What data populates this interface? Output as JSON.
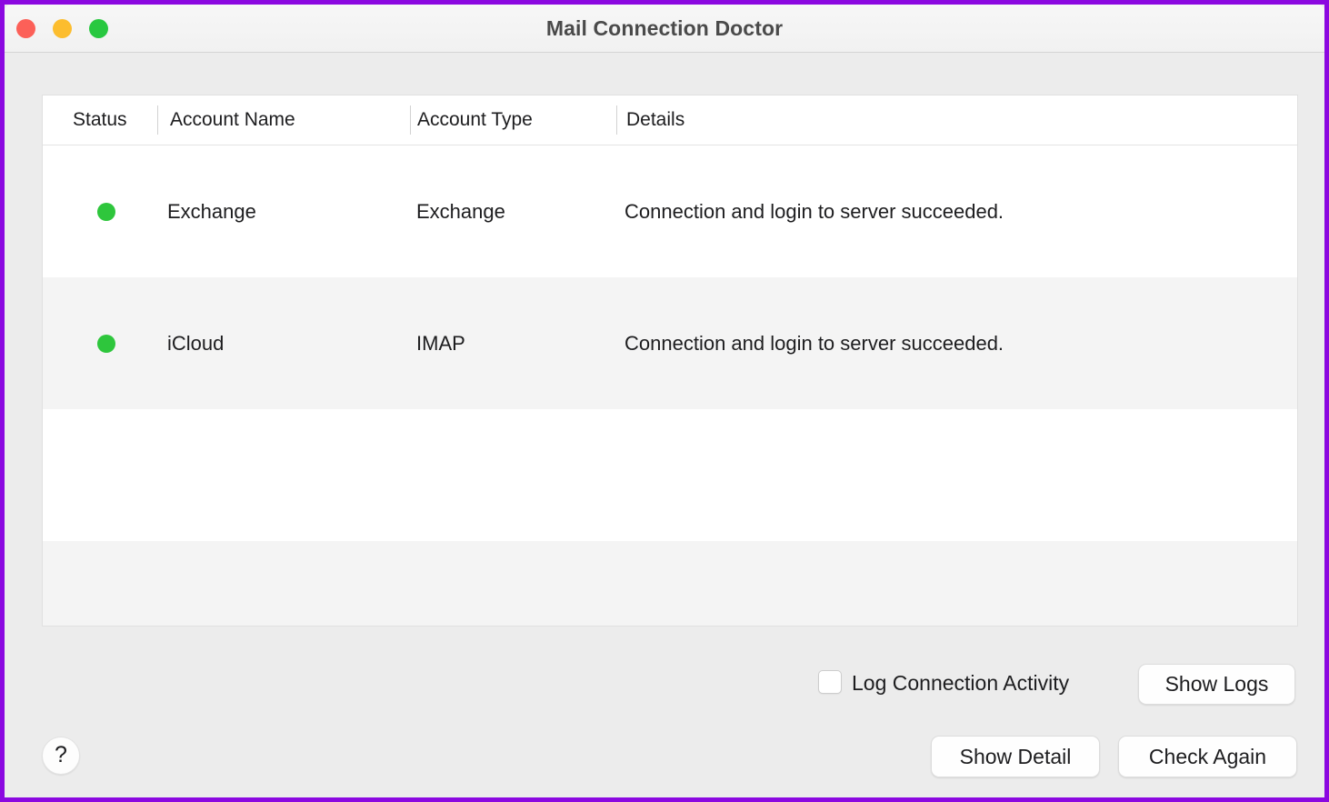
{
  "window": {
    "title": "Mail Connection Doctor",
    "border_color": "#8b08e0",
    "background_color": "#ececec",
    "traffic_lights": [
      {
        "name": "close",
        "color": "#fc6058"
      },
      {
        "name": "minimize",
        "color": "#fcbd2e"
      },
      {
        "name": "zoom",
        "color": "#28c840"
      }
    ]
  },
  "table": {
    "columns": [
      {
        "key": "status",
        "label": "Status"
      },
      {
        "key": "account_name",
        "label": "Account Name"
      },
      {
        "key": "account_type",
        "label": "Account Type"
      },
      {
        "key": "details",
        "label": "Details"
      }
    ],
    "status_ok_color": "#2ec63c",
    "rows": [
      {
        "status": "ok",
        "account_name": "Exchange",
        "account_type": "Exchange",
        "details": "Connection and login to server succeeded."
      },
      {
        "status": "ok",
        "account_name": "iCloud",
        "account_type": "IMAP",
        "details": "Connection and login to server succeeded."
      }
    ]
  },
  "controls": {
    "log_connection_activity": {
      "label": "Log Connection Activity",
      "checked": false
    },
    "show_logs_label": "Show Logs",
    "show_detail_label": "Show Detail",
    "check_again_label": "Check Again",
    "help_label": "?"
  }
}
